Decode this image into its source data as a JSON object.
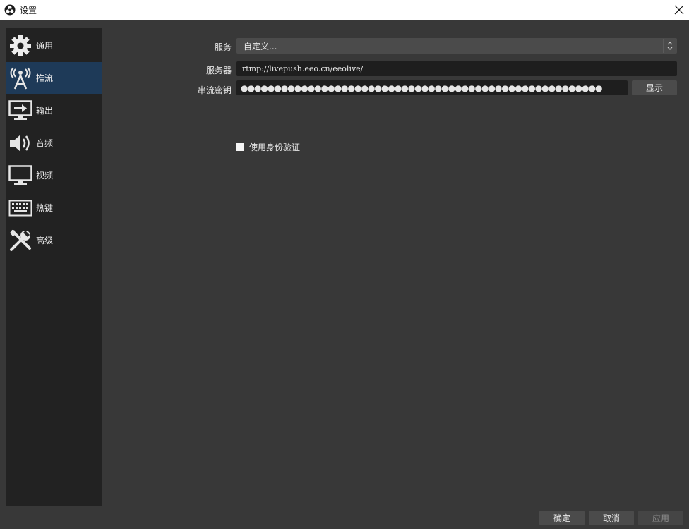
{
  "window": {
    "title": "设置"
  },
  "sidebar": {
    "items": [
      {
        "label": "通用",
        "icon": "gear-icon"
      },
      {
        "label": "推流",
        "icon": "antenna-icon",
        "active": true
      },
      {
        "label": "输出",
        "icon": "output-icon"
      },
      {
        "label": "音频",
        "icon": "speaker-icon"
      },
      {
        "label": "视频",
        "icon": "monitor-icon"
      },
      {
        "label": "热键",
        "icon": "keyboard-icon"
      },
      {
        "label": "高级",
        "icon": "tools-icon"
      }
    ]
  },
  "stream": {
    "service_label": "服务",
    "service_value": "自定义...",
    "server_label": "服务器",
    "server_value": "rtmp://livepush.eeo.cn/eeolive/",
    "key_label": "串流密钥",
    "key_value": "●●●●●●●●●●●●●●●●●●●●●●●●●●●●●●●●●●●●●●●●●●●●●●●●●●●●●●",
    "show_button": "显示",
    "auth_label": "使用身份验证",
    "auth_checked": false
  },
  "footer": {
    "ok": "确定",
    "cancel": "取消",
    "apply": "应用"
  },
  "colors": {
    "window_bg": "#383838",
    "sidebar_bg": "#222222",
    "active_item": "#1e3a58",
    "input_bg": "#1e1e1e",
    "button_bg": "#4b4b4b"
  }
}
